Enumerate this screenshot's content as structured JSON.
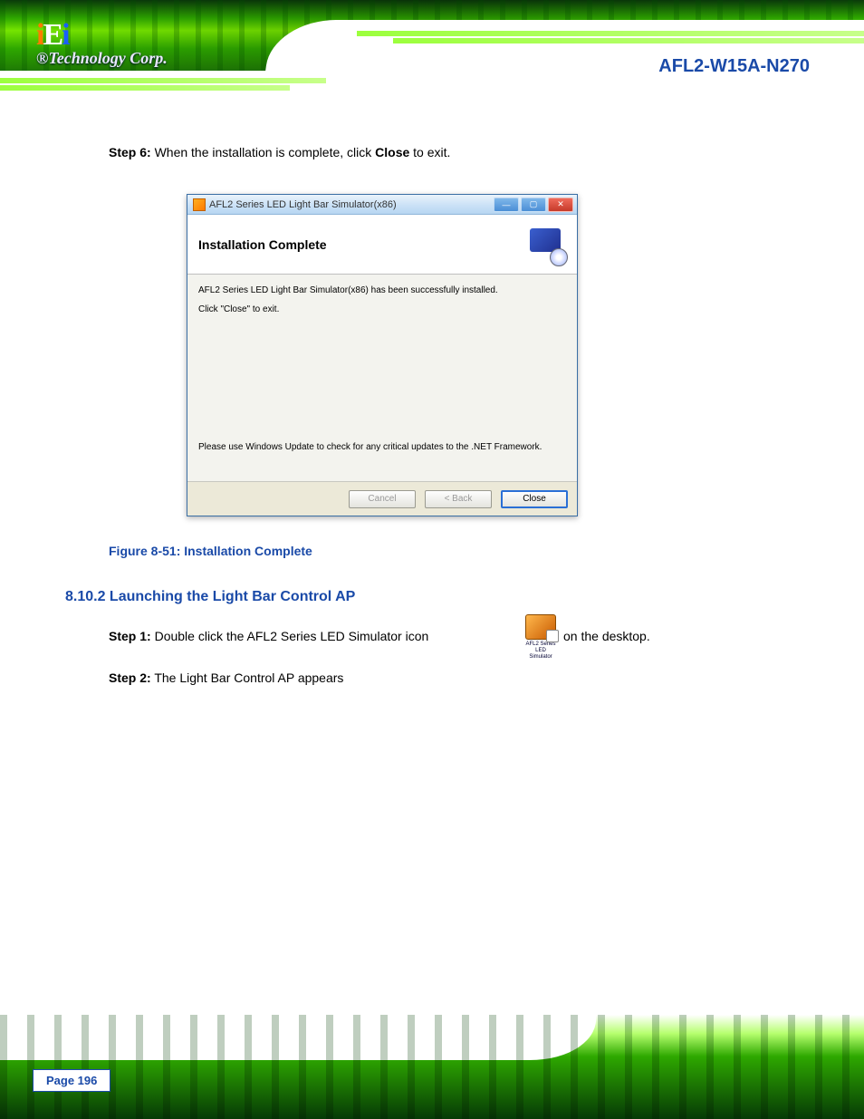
{
  "document": {
    "product_title": "AFL2-W15A-N270",
    "step6_prefix": "Step 6:",
    "step6_text": "When the installation is complete, click ",
    "step6_close": "Close",
    "step6_suffix": " to exit.",
    "figure_caption": "Figure 8-51: Installation Complete",
    "section_title": "8.10.2 Launching the Light Bar Control AP",
    "step1_prefix": "Step 1:",
    "step1_text": "Double click the AFL2 Series LED Simulator icon ",
    "step1_after": " on the desktop.",
    "desktop_icon_label": "AFL2 Series LED Simulator",
    "step2_prefix": "Step 2:",
    "step2_text": "The Light Bar Control AP appears ",
    "page_label": "Page 196",
    "logo_tag": "Technology Corp."
  },
  "dialog": {
    "title": "AFL2 Series LED Light Bar Simulator(x86)",
    "heading": "Installation Complete",
    "line1": "AFL2 Series LED Light Bar Simulator(x86) has been successfully installed.",
    "line2": "Click \"Close\" to exit.",
    "footer_note": "Please use Windows Update to check for any critical updates to the .NET Framework.",
    "buttons": {
      "cancel": "Cancel",
      "back": "< Back",
      "close": "Close"
    }
  }
}
